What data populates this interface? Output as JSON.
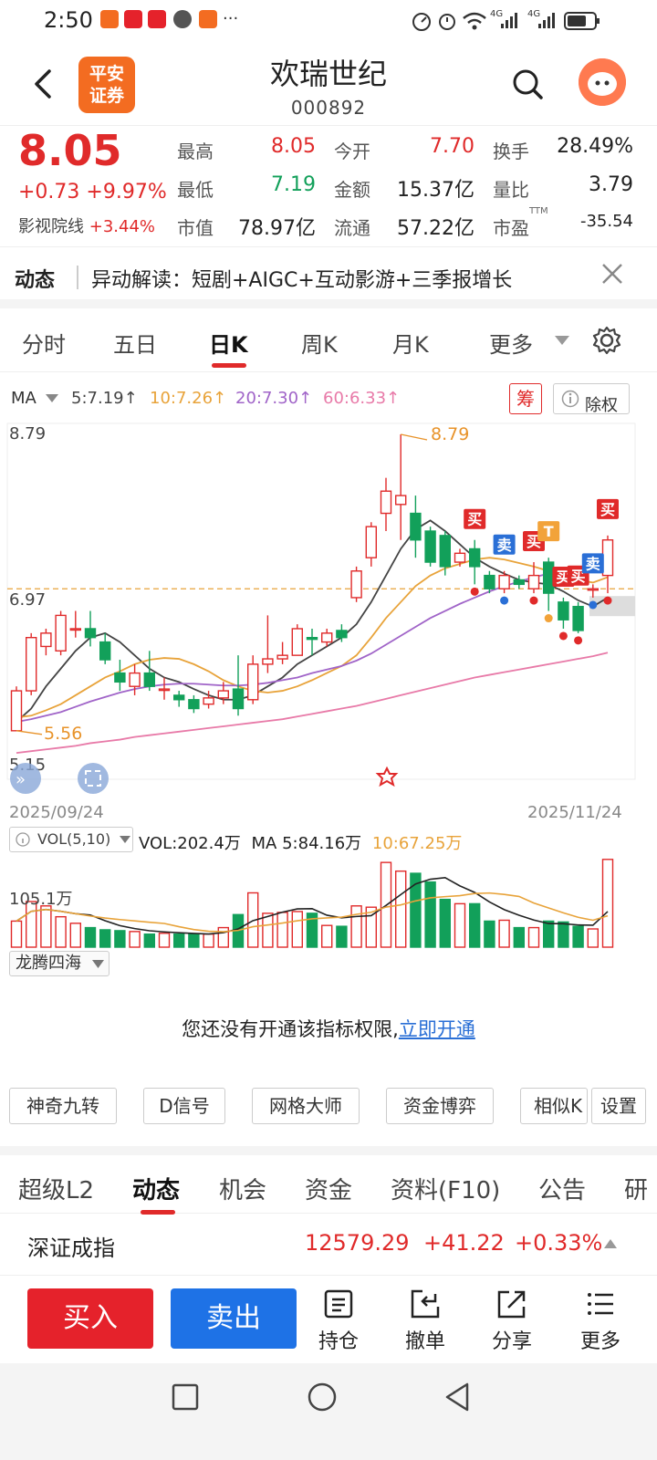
{
  "status": {
    "time": "2:50",
    "more": "···",
    "net1": "4G",
    "net2": "4G"
  },
  "header": {
    "stock_name": "欢瑞世纪",
    "stock_code": "000892",
    "logo_line1": "平安",
    "logo_line2": "证券"
  },
  "quote": {
    "price": "8.05",
    "change": "+0.73",
    "change_pct": "+9.97%",
    "sector_name": "影视院线",
    "sector_pct": "+3.44%",
    "fields": [
      {
        "label": "最高",
        "value": "8.05",
        "color": "#e02a2a"
      },
      {
        "label": "今开",
        "value": "7.70",
        "color": "#e02a2a"
      },
      {
        "label": "换手",
        "value": "28.49%",
        "color": "#222"
      },
      {
        "label": "最低",
        "value": "7.19",
        "color": "#12a05a"
      },
      {
        "label": "金额",
        "value": "15.37亿",
        "color": "#222"
      },
      {
        "label": "量比",
        "value": "3.79",
        "color": "#222"
      },
      {
        "label": "市值",
        "value": "78.97亿",
        "color": "#222"
      },
      {
        "label": "流通",
        "value": "57.22亿",
        "color": "#222"
      },
      {
        "label": "市盈",
        "value": "-35.54",
        "color": "#222"
      }
    ],
    "ttm": "TTM"
  },
  "news": {
    "tag": "动态",
    "text": "异动解读：短剧+AIGC+互动影游+三季报增长"
  },
  "period_tabs": [
    "分时",
    "五日",
    "日K",
    "周K",
    "月K",
    "更多"
  ],
  "ma": {
    "label": "MA",
    "ma5": "5:7.19↑",
    "ma10": "10:7.26↑",
    "ma20": "20:7.30↑",
    "ma60": "60:6.33↑",
    "chou": "筹",
    "chuquan": "除权",
    "colors": {
      "ma5": "#444444",
      "ma10": "#e8a33a",
      "ma20": "#a064c8",
      "ma60": "#e87aa8"
    }
  },
  "chart_data": {
    "type": "candlestick",
    "y_high_label": "8.79",
    "y_mid_label": "6.97",
    "y_low_label": "5.15",
    "max_marker": "8.79",
    "min_marker": "5.56",
    "start_date": "2025/09/24",
    "end_date": "2025/11/24",
    "ylim": [
      5.15,
      8.79
    ],
    "candles": [
      [
        5.45,
        5.9,
        5.95,
        5.45
      ],
      [
        5.9,
        6.5,
        6.55,
        5.85
      ],
      [
        6.4,
        6.55,
        6.6,
        6.3
      ],
      [
        6.35,
        6.75,
        6.8,
        6.3
      ],
      [
        6.6,
        6.6,
        6.8,
        6.5
      ],
      [
        6.6,
        6.5,
        6.8,
        6.4
      ],
      [
        6.45,
        6.25,
        6.55,
        6.2
      ],
      [
        6.1,
        6.0,
        6.25,
        5.9
      ],
      [
        5.95,
        6.1,
        6.2,
        5.85
      ],
      [
        6.1,
        5.95,
        6.35,
        5.9
      ],
      [
        5.92,
        5.92,
        6.05,
        5.8
      ],
      [
        5.85,
        5.8,
        5.9,
        5.72
      ],
      [
        5.8,
        5.7,
        5.85,
        5.65
      ],
      [
        5.75,
        5.82,
        5.9,
        5.7
      ],
      [
        5.82,
        5.9,
        6.0,
        5.75
      ],
      [
        5.92,
        5.7,
        6.3,
        5.62
      ],
      [
        5.8,
        6.2,
        6.3,
        5.75
      ],
      [
        6.2,
        6.26,
        6.75,
        6.1
      ],
      [
        6.26,
        6.3,
        6.45,
        6.2
      ],
      [
        6.3,
        6.6,
        6.65,
        6.3
      ],
      [
        6.5,
        6.48,
        6.6,
        6.3
      ],
      [
        6.45,
        6.55,
        6.6,
        6.4
      ],
      [
        6.58,
        6.5,
        6.65,
        6.45
      ],
      [
        6.95,
        7.25,
        7.3,
        6.9
      ],
      [
        7.4,
        7.75,
        7.8,
        7.3
      ],
      [
        7.9,
        8.15,
        8.3,
        7.7
      ],
      [
        8.0,
        8.1,
        8.79,
        7.6
      ],
      [
        7.9,
        7.6,
        8.1,
        7.4
      ],
      [
        7.7,
        7.35,
        7.75,
        7.3
      ],
      [
        7.65,
        7.3,
        7.7,
        7.2
      ],
      [
        7.35,
        7.45,
        7.5,
        7.3
      ],
      [
        7.5,
        7.3,
        7.6,
        7.1
      ],
      [
        7.2,
        7.05,
        7.25,
        7.0
      ],
      [
        7.05,
        7.2,
        7.25,
        7.0
      ],
      [
        7.15,
        7.1,
        7.2,
        7.05
      ],
      [
        7.05,
        7.2,
        7.35,
        7.0
      ],
      [
        7.35,
        7.0,
        7.4,
        6.8
      ],
      [
        6.9,
        6.7,
        6.95,
        6.6
      ],
      [
        6.85,
        6.58,
        6.9,
        6.55
      ],
      [
        7.05,
        7.05,
        7.1,
        6.95
      ],
      [
        7.2,
        7.6,
        7.65,
        7.0
      ]
    ],
    "ma5": [
      5.55,
      5.7,
      5.95,
      6.15,
      6.35,
      6.5,
      6.55,
      6.45,
      6.3,
      6.15,
      6.05,
      6.0,
      5.92,
      5.85,
      5.8,
      5.8,
      5.85,
      5.95,
      6.05,
      6.2,
      6.3,
      6.4,
      6.5,
      6.65,
      6.9,
      7.2,
      7.5,
      7.72,
      7.82,
      7.7,
      7.55,
      7.4,
      7.3,
      7.22,
      7.15,
      7.12,
      7.1,
      7.02,
      6.92,
      6.85,
      6.95
    ],
    "ma10": [
      5.6,
      5.62,
      5.68,
      5.75,
      5.85,
      5.95,
      6.05,
      6.12,
      6.2,
      6.25,
      6.27,
      6.26,
      6.2,
      6.12,
      6.02,
      5.95,
      5.9,
      5.88,
      5.9,
      5.95,
      6.02,
      6.1,
      6.18,
      6.3,
      6.5,
      6.72,
      6.9,
      7.08,
      7.2,
      7.28,
      7.33,
      7.38,
      7.4,
      7.38,
      7.34,
      7.3,
      7.25,
      7.2,
      7.15,
      7.12,
      7.18
    ],
    "ma20": [
      5.55,
      5.58,
      5.62,
      5.66,
      5.72,
      5.78,
      5.83,
      5.88,
      5.92,
      5.95,
      5.97,
      5.98,
      5.98,
      5.97,
      5.96,
      5.96,
      5.97,
      5.99,
      6.02,
      6.05,
      6.1,
      6.14,
      6.18,
      6.24,
      6.32,
      6.42,
      6.52,
      6.62,
      6.72,
      6.8,
      6.88,
      6.95,
      7.02,
      7.08,
      7.13,
      7.18,
      7.22,
      7.25,
      7.27,
      7.28,
      7.3
    ],
    "ma60": [
      5.2,
      5.22,
      5.24,
      5.26,
      5.28,
      5.31,
      5.33,
      5.35,
      5.38,
      5.4,
      5.42,
      5.44,
      5.46,
      5.48,
      5.5,
      5.52,
      5.54,
      5.56,
      5.58,
      5.61,
      5.64,
      5.67,
      5.7,
      5.73,
      5.77,
      5.81,
      5.85,
      5.89,
      5.93,
      5.97,
      6.01,
      6.05,
      6.08,
      6.11,
      6.14,
      6.17,
      6.2,
      6.23,
      6.26,
      6.29,
      6.33
    ],
    "signals": [
      {
        "index": 31,
        "text": "买",
        "color": "#e02a2a"
      },
      {
        "index": 33,
        "text": "卖",
        "color": "#2a6fd6"
      },
      {
        "index": 35,
        "text": "买",
        "color": "#e02a2a"
      },
      {
        "index": 36,
        "text": "T",
        "color": "#f2a33a"
      },
      {
        "index": 37,
        "text": "买",
        "color": "#e02a2a"
      },
      {
        "index": 38,
        "text": "买",
        "color": "#e02a2a"
      },
      {
        "index": 39,
        "text": "卖",
        "color": "#2a6fd6"
      },
      {
        "index": 40,
        "text": "买",
        "color": "#e02a2a"
      }
    ]
  },
  "volume": {
    "header": "VOL(5,10)",
    "vol_label": "VOL:202.4万",
    "ma5_label": "MA 5:84.16万",
    "ma10_label": "10:67.25万",
    "scale_label": "105.1万",
    "ylim": [
      0,
      210
    ],
    "values": [
      60,
      105,
      95,
      70,
      55,
      45,
      40,
      38,
      36,
      30,
      32,
      30,
      30,
      30,
      45,
      75,
      125,
      78,
      80,
      82,
      78,
      50,
      48,
      95,
      92,
      195,
      175,
      170,
      150,
      110,
      100,
      100,
      60,
      62,
      45,
      45,
      60,
      58,
      48,
      42,
      202
    ]
  },
  "indicator": {
    "name": "龙腾四海",
    "no_perm": "您还没有开通该指标权限,",
    "open_link": "立即开通"
  },
  "tools": [
    "神奇九转",
    "D信号",
    "网格大师",
    "资金博弈",
    "相似K",
    "设置"
  ],
  "bottom_tabs": [
    "超级L2",
    "动态",
    "机会",
    "资金",
    "资料(F10)",
    "公告",
    "研"
  ],
  "index": {
    "name": "深证成指",
    "value": "12579.29",
    "change": "+41.22",
    "pct": "+0.33%"
  },
  "trade": {
    "buy": "买入",
    "sell": "卖出",
    "hold": "持仓",
    "cancel": "撤单",
    "share": "分享",
    "more": "更多"
  }
}
